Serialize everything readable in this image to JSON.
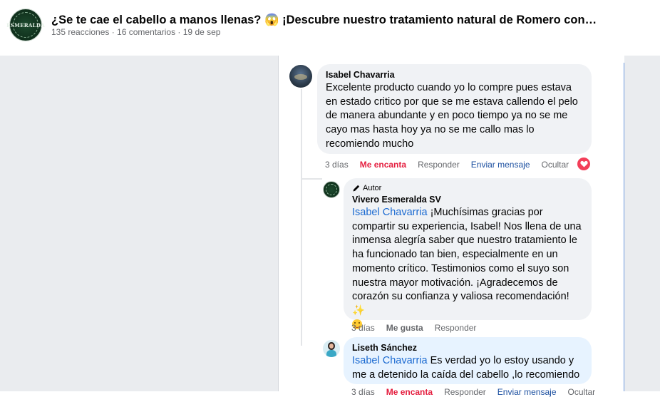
{
  "post": {
    "logo_brand": "ESMERALDA",
    "title": "¿Se te cae el cabello a manos llenas? 😱 ¡Descubre nuestro tratamiento natural de Romero con…",
    "meta": "135 reacciones · 16 comentarios · 19 de sep"
  },
  "comments": [
    {
      "author": "Isabel Chavarria",
      "text": "Excelente producto cuando yo lo compre pues estava en estado critico por que se me estava callendo el pelo de manera abundante y en poco tiempo ya no se me cayo mas hasta hoy ya no se me callo mas lo recomiendo mucho",
      "time": "3 días",
      "reaction_label": "Me encanta",
      "reply_label": "Responder",
      "message_label": "Enviar mensaje",
      "hide_label": "Ocultar"
    },
    {
      "badge": "Autor",
      "author": "Vivero Esmeralda SV",
      "mention": "Isabel Chavarria",
      "text": " ¡Muchísimas gracias por compartir su experiencia, Isabel! Nos llena de una inmensa alegría saber que nuestro tratamiento le ha funcionado tan bien, especialmente en un momento crítico. Testimonios como el suyo son nuestra mayor motivación. ¡Agradecemos de corazón su confianza y valiosa recomendación! ✨",
      "time": "3 días",
      "like_label": "Me gusta",
      "reply_label": "Responder"
    },
    {
      "author": "Liseth Sánchez",
      "mention": "Isabel Chavarria",
      "text": " Es verdad yo lo estoy usando y me a detenido la caída del cabello ,lo recomiendo",
      "time": "3 días",
      "reaction_label": "Me encanta",
      "reply_label": "Responder",
      "message_label": "Enviar mensaje",
      "hide_label": "Ocultar"
    }
  ],
  "colors": {
    "love": "#e41e3f",
    "mention": "#1b6ad1",
    "bubble": "#f0f2f5",
    "bubble_highlight": "#e7f3ff"
  },
  "icons": [
    "pencil-icon",
    "heart-reaction-icon",
    "smiling-face-emoji-icon",
    "sparkles-emoji-icon"
  ]
}
